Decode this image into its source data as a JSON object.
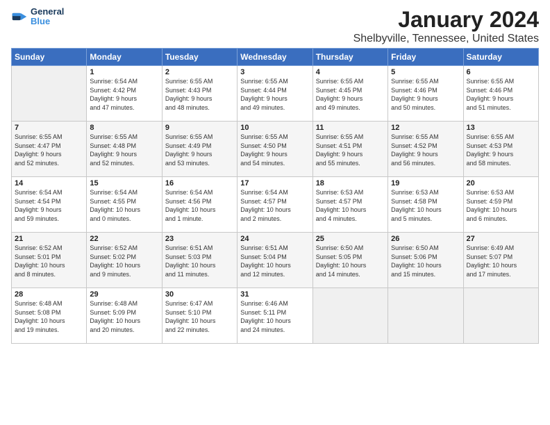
{
  "header": {
    "logo_line1": "General",
    "logo_line2": "Blue",
    "month": "January 2024",
    "location": "Shelbyville, Tennessee, United States"
  },
  "days_of_week": [
    "Sunday",
    "Monday",
    "Tuesday",
    "Wednesday",
    "Thursday",
    "Friday",
    "Saturday"
  ],
  "weeks": [
    [
      {
        "num": "",
        "info": ""
      },
      {
        "num": "1",
        "info": "Sunrise: 6:54 AM\nSunset: 4:42 PM\nDaylight: 9 hours\nand 47 minutes."
      },
      {
        "num": "2",
        "info": "Sunrise: 6:55 AM\nSunset: 4:43 PM\nDaylight: 9 hours\nand 48 minutes."
      },
      {
        "num": "3",
        "info": "Sunrise: 6:55 AM\nSunset: 4:44 PM\nDaylight: 9 hours\nand 49 minutes."
      },
      {
        "num": "4",
        "info": "Sunrise: 6:55 AM\nSunset: 4:45 PM\nDaylight: 9 hours\nand 49 minutes."
      },
      {
        "num": "5",
        "info": "Sunrise: 6:55 AM\nSunset: 4:46 PM\nDaylight: 9 hours\nand 50 minutes."
      },
      {
        "num": "6",
        "info": "Sunrise: 6:55 AM\nSunset: 4:46 PM\nDaylight: 9 hours\nand 51 minutes."
      }
    ],
    [
      {
        "num": "7",
        "info": "Sunrise: 6:55 AM\nSunset: 4:47 PM\nDaylight: 9 hours\nand 52 minutes."
      },
      {
        "num": "8",
        "info": "Sunrise: 6:55 AM\nSunset: 4:48 PM\nDaylight: 9 hours\nand 52 minutes."
      },
      {
        "num": "9",
        "info": "Sunrise: 6:55 AM\nSunset: 4:49 PM\nDaylight: 9 hours\nand 53 minutes."
      },
      {
        "num": "10",
        "info": "Sunrise: 6:55 AM\nSunset: 4:50 PM\nDaylight: 9 hours\nand 54 minutes."
      },
      {
        "num": "11",
        "info": "Sunrise: 6:55 AM\nSunset: 4:51 PM\nDaylight: 9 hours\nand 55 minutes."
      },
      {
        "num": "12",
        "info": "Sunrise: 6:55 AM\nSunset: 4:52 PM\nDaylight: 9 hours\nand 56 minutes."
      },
      {
        "num": "13",
        "info": "Sunrise: 6:55 AM\nSunset: 4:53 PM\nDaylight: 9 hours\nand 58 minutes."
      }
    ],
    [
      {
        "num": "14",
        "info": "Sunrise: 6:54 AM\nSunset: 4:54 PM\nDaylight: 9 hours\nand 59 minutes."
      },
      {
        "num": "15",
        "info": "Sunrise: 6:54 AM\nSunset: 4:55 PM\nDaylight: 10 hours\nand 0 minutes."
      },
      {
        "num": "16",
        "info": "Sunrise: 6:54 AM\nSunset: 4:56 PM\nDaylight: 10 hours\nand 1 minute."
      },
      {
        "num": "17",
        "info": "Sunrise: 6:54 AM\nSunset: 4:57 PM\nDaylight: 10 hours\nand 2 minutes."
      },
      {
        "num": "18",
        "info": "Sunrise: 6:53 AM\nSunset: 4:57 PM\nDaylight: 10 hours\nand 4 minutes."
      },
      {
        "num": "19",
        "info": "Sunrise: 6:53 AM\nSunset: 4:58 PM\nDaylight: 10 hours\nand 5 minutes."
      },
      {
        "num": "20",
        "info": "Sunrise: 6:53 AM\nSunset: 4:59 PM\nDaylight: 10 hours\nand 6 minutes."
      }
    ],
    [
      {
        "num": "21",
        "info": "Sunrise: 6:52 AM\nSunset: 5:01 PM\nDaylight: 10 hours\nand 8 minutes."
      },
      {
        "num": "22",
        "info": "Sunrise: 6:52 AM\nSunset: 5:02 PM\nDaylight: 10 hours\nand 9 minutes."
      },
      {
        "num": "23",
        "info": "Sunrise: 6:51 AM\nSunset: 5:03 PM\nDaylight: 10 hours\nand 11 minutes."
      },
      {
        "num": "24",
        "info": "Sunrise: 6:51 AM\nSunset: 5:04 PM\nDaylight: 10 hours\nand 12 minutes."
      },
      {
        "num": "25",
        "info": "Sunrise: 6:50 AM\nSunset: 5:05 PM\nDaylight: 10 hours\nand 14 minutes."
      },
      {
        "num": "26",
        "info": "Sunrise: 6:50 AM\nSunset: 5:06 PM\nDaylight: 10 hours\nand 15 minutes."
      },
      {
        "num": "27",
        "info": "Sunrise: 6:49 AM\nSunset: 5:07 PM\nDaylight: 10 hours\nand 17 minutes."
      }
    ],
    [
      {
        "num": "28",
        "info": "Sunrise: 6:48 AM\nSunset: 5:08 PM\nDaylight: 10 hours\nand 19 minutes."
      },
      {
        "num": "29",
        "info": "Sunrise: 6:48 AM\nSunset: 5:09 PM\nDaylight: 10 hours\nand 20 minutes."
      },
      {
        "num": "30",
        "info": "Sunrise: 6:47 AM\nSunset: 5:10 PM\nDaylight: 10 hours\nand 22 minutes."
      },
      {
        "num": "31",
        "info": "Sunrise: 6:46 AM\nSunset: 5:11 PM\nDaylight: 10 hours\nand 24 minutes."
      },
      {
        "num": "",
        "info": ""
      },
      {
        "num": "",
        "info": ""
      },
      {
        "num": "",
        "info": ""
      }
    ]
  ]
}
